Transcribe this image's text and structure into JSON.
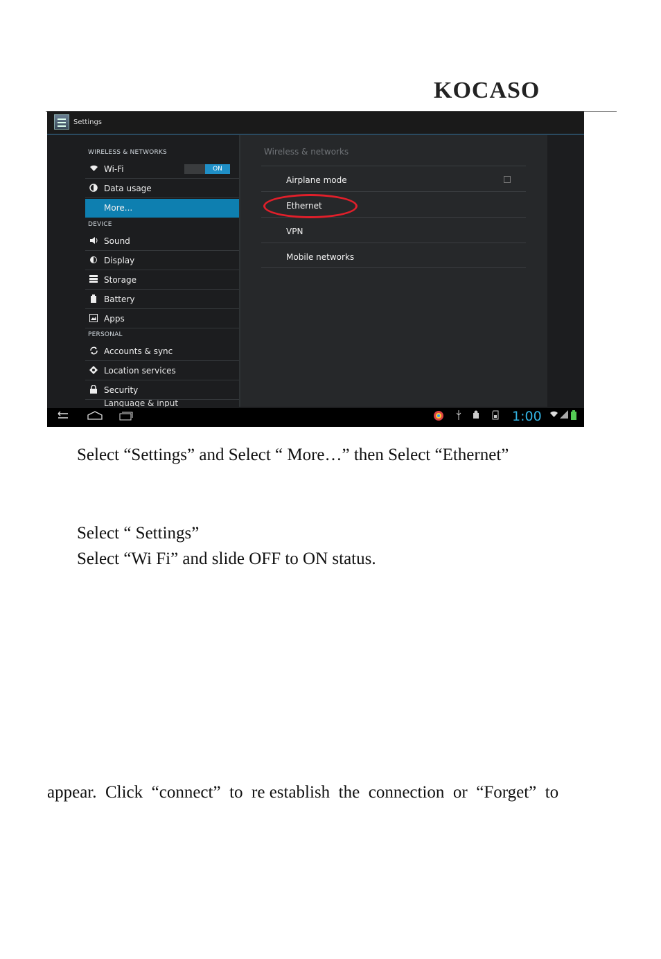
{
  "logo": "KOCASO",
  "screenshot": {
    "title": "Settings",
    "sections": {
      "wireless": "WIRELESS & NETWORKS",
      "device": "DEVICE",
      "personal": "PERSONAL"
    },
    "items": [
      {
        "label": "Wi-Fi",
        "icon": "wifi-icon"
      },
      {
        "label": "Data usage",
        "icon": "data-usage-icon"
      },
      {
        "label": "More...",
        "icon": ""
      },
      {
        "label": "Sound",
        "icon": "sound-icon"
      },
      {
        "label": "Display",
        "icon": "display-icon"
      },
      {
        "label": "Storage",
        "icon": "storage-icon"
      },
      {
        "label": "Battery",
        "icon": "battery-icon"
      },
      {
        "label": "Apps",
        "icon": "apps-icon"
      },
      {
        "label": "Accounts & sync",
        "icon": "sync-icon"
      },
      {
        "label": "Location services",
        "icon": "location-icon"
      },
      {
        "label": "Security",
        "icon": "lock-icon"
      },
      {
        "label": "Language & input",
        "icon": "language-icon"
      }
    ],
    "wifi_toggle": "ON",
    "right_header": "Wireless & networks",
    "right_items": [
      "Airplane mode",
      "Ethernet",
      "VPN",
      "Mobile networks"
    ],
    "clock": "1:00",
    "accent": "#0e7fb0",
    "highlight_color": "#e01f2a"
  },
  "text": {
    "line1": "Select “Settings” and Select “ More…” then Select “Ethernet”",
    "line2": "Select “ Settings”",
    "line3": "Select “Wi Fi” and slide OFF to ON status.",
    "line4": "appear.  Click  “connect”  to  re establish  the  connection  or  “Forget”  to"
  }
}
